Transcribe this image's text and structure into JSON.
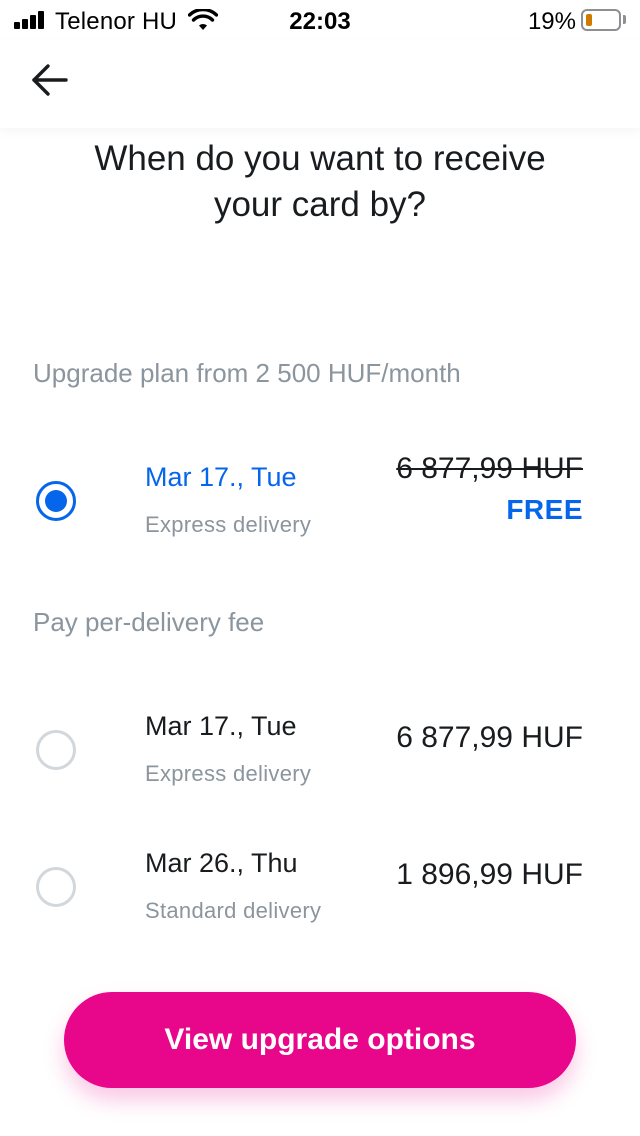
{
  "status_bar": {
    "carrier": "Telenor HU",
    "time": "22:03",
    "battery_percent": "19%",
    "battery_level": 0.19,
    "icons": [
      "signal-icon",
      "wifi-icon",
      "battery-icon"
    ]
  },
  "nav": {
    "back_icon": "arrow-left-icon"
  },
  "title": "When do you want to receive your card by?",
  "sections": [
    {
      "label": "Upgrade plan from 2 500 HUF/month",
      "options": [
        {
          "date": "Mar 17., Tue",
          "type": "Express delivery",
          "price": "6 877,99 HUF",
          "price_struck": true,
          "badge": "FREE",
          "selected": true
        }
      ]
    },
    {
      "label": "Pay per-delivery fee",
      "options": [
        {
          "date": "Mar 17., Tue",
          "type": "Express delivery",
          "price": "6 877,99 HUF",
          "selected": false
        },
        {
          "date": "Mar 26., Thu",
          "type": "Standard delivery",
          "price": "1 896,99 HUF",
          "selected": false
        }
      ]
    }
  ],
  "cta": {
    "label": "View upgrade options"
  },
  "colors": {
    "accent_blue": "#0666eb",
    "cta_pink": "#e8068a",
    "muted_text": "#8b959e",
    "primary_text": "#191c1f"
  }
}
